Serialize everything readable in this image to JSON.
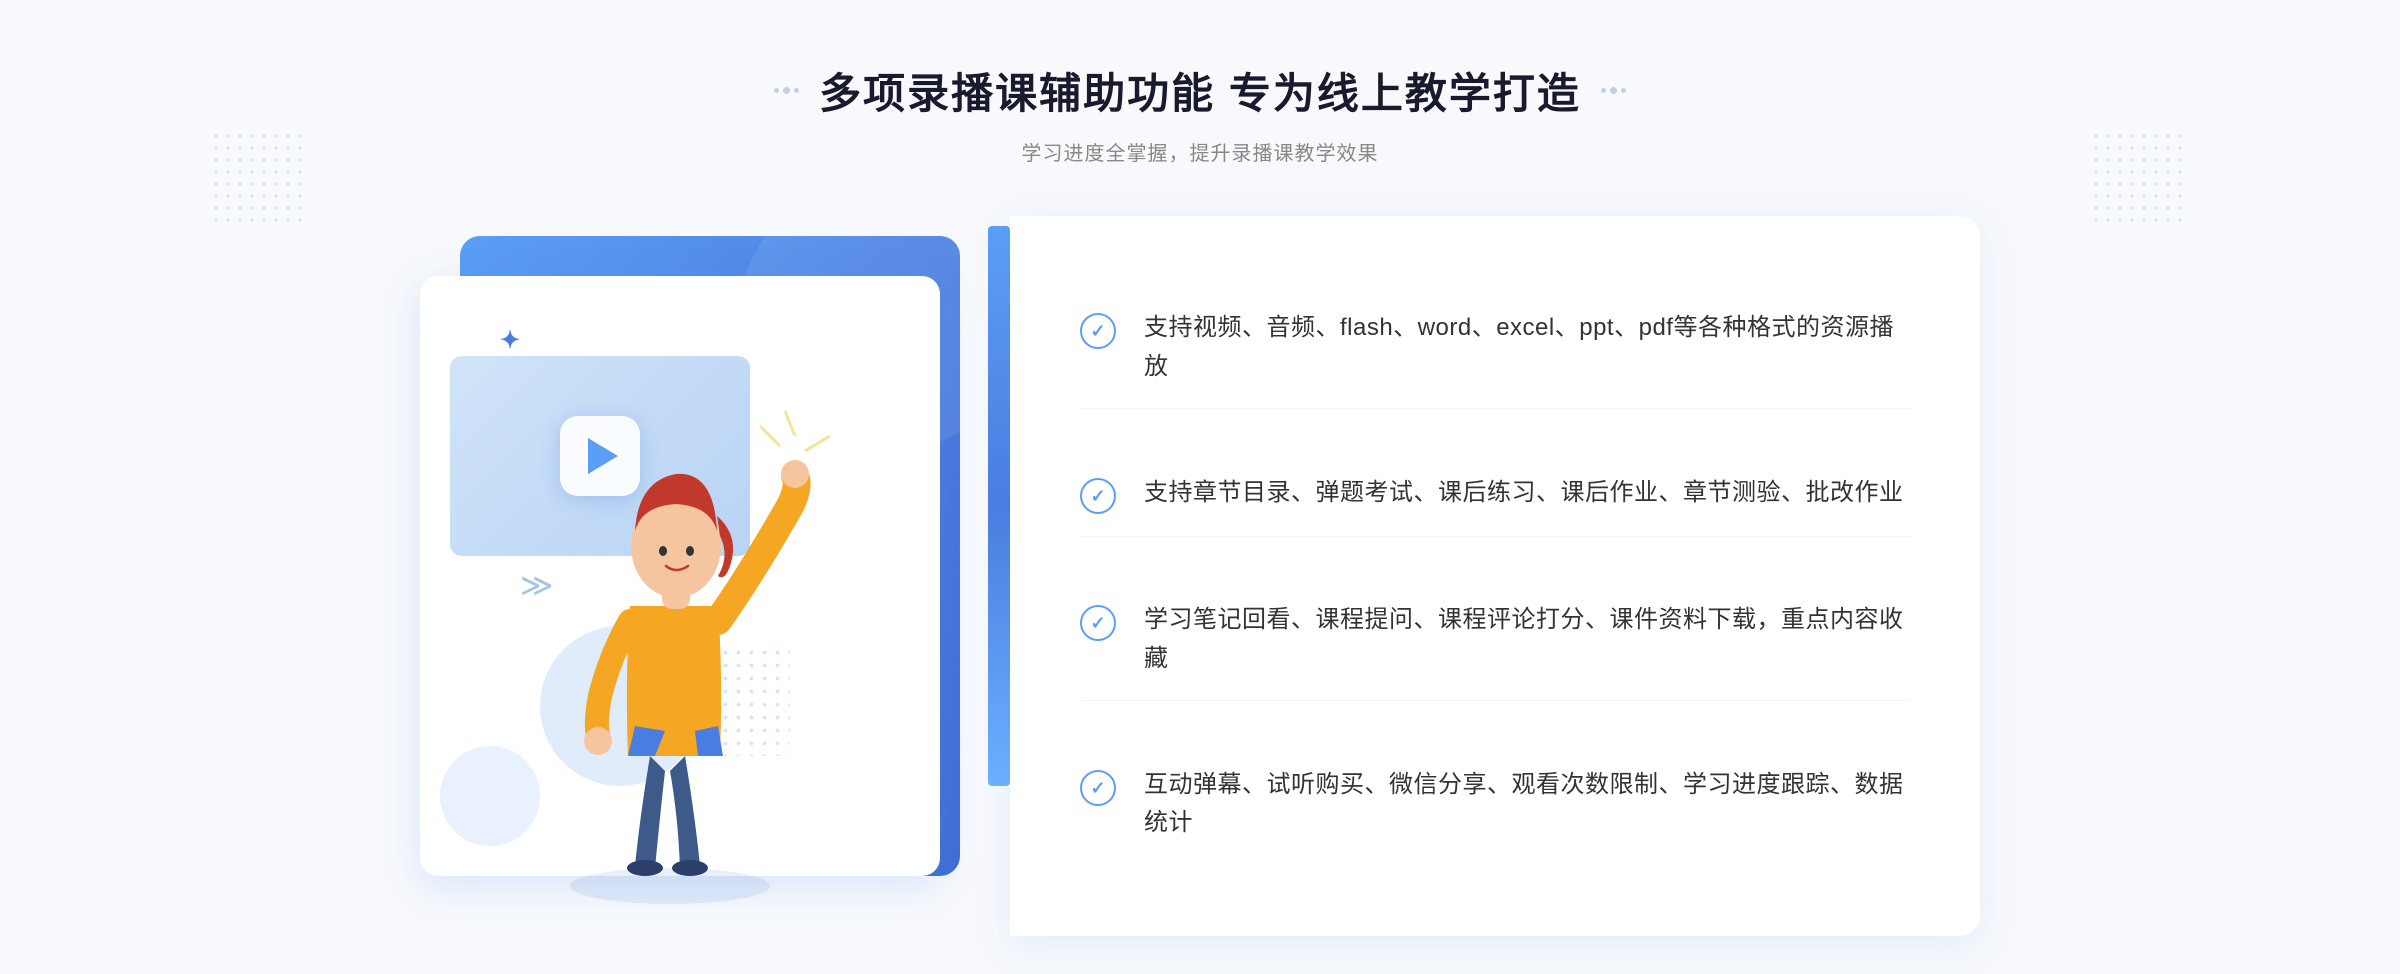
{
  "header": {
    "title": "多项录播课辅助功能 专为线上教学打造",
    "subtitle": "学习进度全掌握，提升录播课教学效果"
  },
  "features": [
    {
      "id": 1,
      "text": "支持视频、音频、flash、word、excel、ppt、pdf等各种格式的资源播放"
    },
    {
      "id": 2,
      "text": "支持章节目录、弹题考试、课后练习、课后作业、章节测验、批改作业"
    },
    {
      "id": 3,
      "text": "学习笔记回看、课程提问、课程评论打分、课件资料下载，重点内容收藏"
    },
    {
      "id": 4,
      "text": "互动弹幕、试听购买、微信分享、观看次数限制、学习进度跟踪、数据统计"
    }
  ]
}
